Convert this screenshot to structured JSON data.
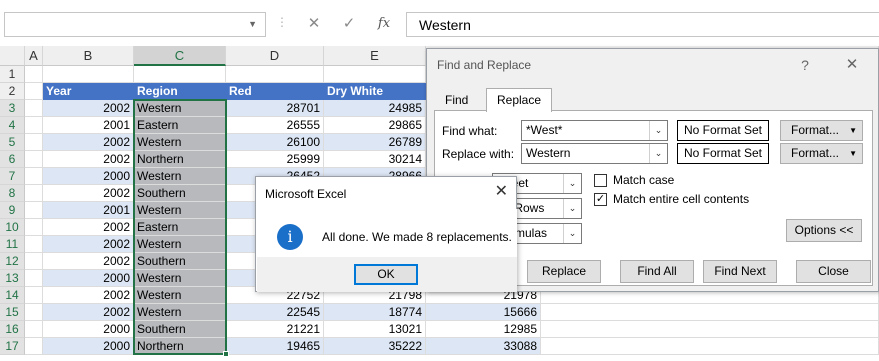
{
  "formula_bar": {
    "name_box_value": "",
    "cancel_icon": "✕",
    "enter_icon": "✓",
    "fx_label": "fx",
    "formula_value": "Western"
  },
  "columns": [
    "A",
    "B",
    "C",
    "D",
    "E"
  ],
  "row_numbers": [
    "1",
    "2",
    "3",
    "4",
    "5",
    "6",
    "7",
    "8",
    "9",
    "10",
    "11",
    "12",
    "13",
    "14",
    "15",
    "16",
    "17"
  ],
  "table": {
    "headers": [
      "Year",
      "Region",
      "Red",
      "Dry White"
    ],
    "rows": [
      {
        "year": "2002",
        "region": "Western",
        "red": "28701",
        "white": "24985",
        "f": ""
      },
      {
        "year": "2001",
        "region": "Eastern",
        "red": "26555",
        "white": "29865",
        "f": ""
      },
      {
        "year": "2002",
        "region": "Western",
        "red": "26100",
        "white": "26789",
        "f": ""
      },
      {
        "year": "2002",
        "region": "Northern",
        "red": "25999",
        "white": "30214",
        "f": ""
      },
      {
        "year": "2000",
        "region": "Western",
        "red": "26452",
        "white": "28966",
        "f": ""
      },
      {
        "year": "2002",
        "region": "Southern",
        "red": "",
        "white": "",
        "f": ""
      },
      {
        "year": "2001",
        "region": "Western",
        "red": "",
        "white": "",
        "f": ""
      },
      {
        "year": "2002",
        "region": "Eastern",
        "red": "",
        "white": "",
        "f": ""
      },
      {
        "year": "2002",
        "region": "Western",
        "red": "",
        "white": "",
        "f": ""
      },
      {
        "year": "2002",
        "region": "Southern",
        "red": "",
        "white": "",
        "f": ""
      },
      {
        "year": "2000",
        "region": "Western",
        "red": "",
        "white": "",
        "f": ""
      },
      {
        "year": "2002",
        "region": "Western",
        "red": "22752",
        "white": "21798",
        "f": "21978"
      },
      {
        "year": "2002",
        "region": "Western",
        "red": "22545",
        "white": "18774",
        "f": "15666"
      },
      {
        "year": "2000",
        "region": "Southern",
        "red": "21221",
        "white": "13021",
        "f": "12985"
      },
      {
        "year": "2000",
        "region": "Northern",
        "red": "19465",
        "white": "35222",
        "f": "33088"
      }
    ]
  },
  "find_replace": {
    "title": "Find and Replace",
    "help": "?",
    "close": "✕",
    "tab_find": "Find",
    "tab_replace": "Replace",
    "find_what_label": "Find what:",
    "find_what_value": "*West*",
    "replace_with_label": "Replace with:",
    "replace_with_value": "Western",
    "no_format_set": "No Format Set",
    "format_label": "Format...",
    "within_value": "Sheet",
    "search_value": "By Rows",
    "look_in_value": "Formulas",
    "match_case": "Match case",
    "match_entire": "Match entire cell contents",
    "options_btn": "Options <<",
    "replace_btn": "Replace",
    "find_all_btn": "Find All",
    "find_next_btn": "Find Next",
    "close_btn": "Close"
  },
  "message_box": {
    "title": "Microsoft Excel",
    "text": "All done. We made 8 replacements.",
    "ok": "OK",
    "close": "✕",
    "info_glyph": "i"
  },
  "colors": {
    "header_blue": "#4472c4",
    "band_blue": "#dde6f4",
    "selection_gray": "#b7b9bd",
    "excel_green": "#217346",
    "info_blue": "#1a6fc9"
  }
}
